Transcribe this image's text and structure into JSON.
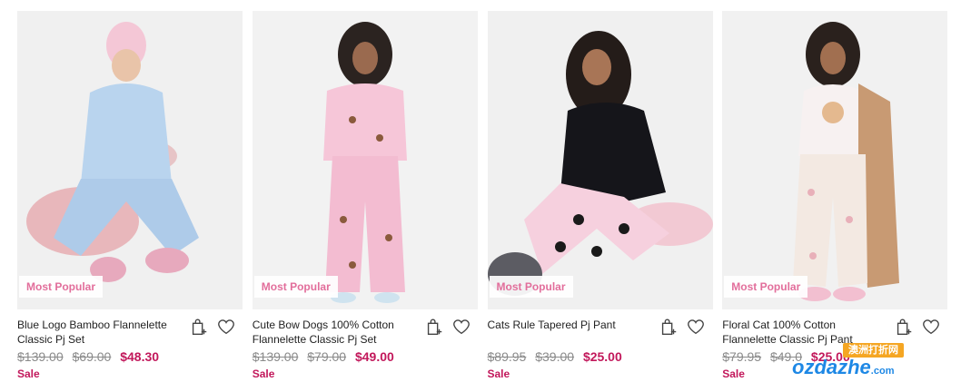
{
  "products": [
    {
      "badge": "Most Popular",
      "name": "Blue Logo Bamboo Flannelette Classic Pj Set",
      "was_price_1": "$139.00",
      "was_price_2": "$69.00",
      "price": "$48.30",
      "sale_label": "Sale",
      "image": "model-blue-pyjama-set"
    },
    {
      "badge": "Most Popular",
      "name": "Cute Bow Dogs 100% Cotton Flannelette Classic Pj Set",
      "was_price_1": "$139.00",
      "was_price_2": "$79.00",
      "price": "$49.00",
      "sale_label": "Sale",
      "image": "model-pink-dog-print-pyjama-set"
    },
    {
      "badge": "Most Popular",
      "name": "Cats Rule Tapered Pj Pant",
      "was_price_1": "$89.95",
      "was_price_2": "$39.00",
      "price": "$25.00",
      "sale_label": "Sale",
      "image": "model-pink-cat-print-pant"
    },
    {
      "badge": "Most Popular",
      "name": "Floral Cat 100% Cotton Flannelette Classic Pj Pant",
      "was_price_1": "$79.95",
      "was_price_2": "$49.0",
      "price": "$25.00",
      "sale_label": "Sale",
      "image": "model-floral-cat-pant"
    }
  ],
  "watermark": {
    "top_text": "澳洲打折网",
    "logo_text": "ozdazhe",
    "logo_suffix": ".com"
  },
  "colors": {
    "badge_text": "#e26e9b",
    "sale_price": "#c2185b",
    "strike_price": "#8a8a8a",
    "image_bg": "#f1f1f1"
  }
}
